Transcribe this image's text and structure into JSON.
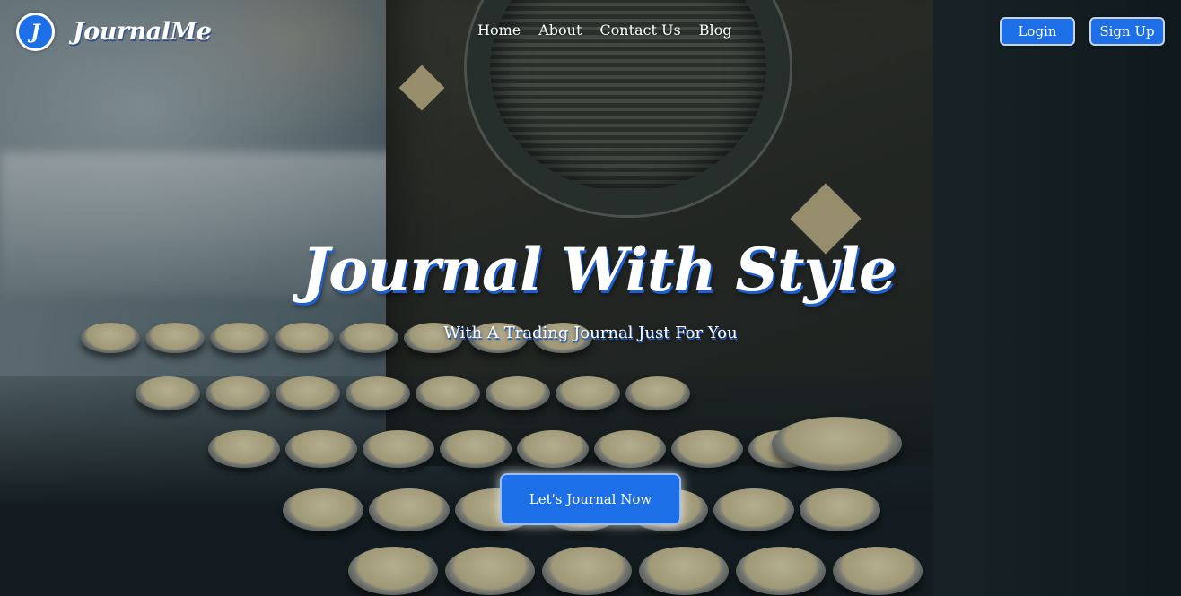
{
  "brand": {
    "badge_letter": "J",
    "name": "JournalMe"
  },
  "nav": {
    "links": [
      "Home",
      "About",
      "Contact Us",
      "Blog"
    ],
    "login_label": "Login",
    "signup_label": "Sign Up"
  },
  "hero": {
    "title": "Journal With Style",
    "subtitle": "With A Trading Journal Just For You",
    "cta_label": "Let's Journal Now"
  },
  "colors": {
    "accent": "#1d6fe8",
    "text": "#ffffff"
  }
}
